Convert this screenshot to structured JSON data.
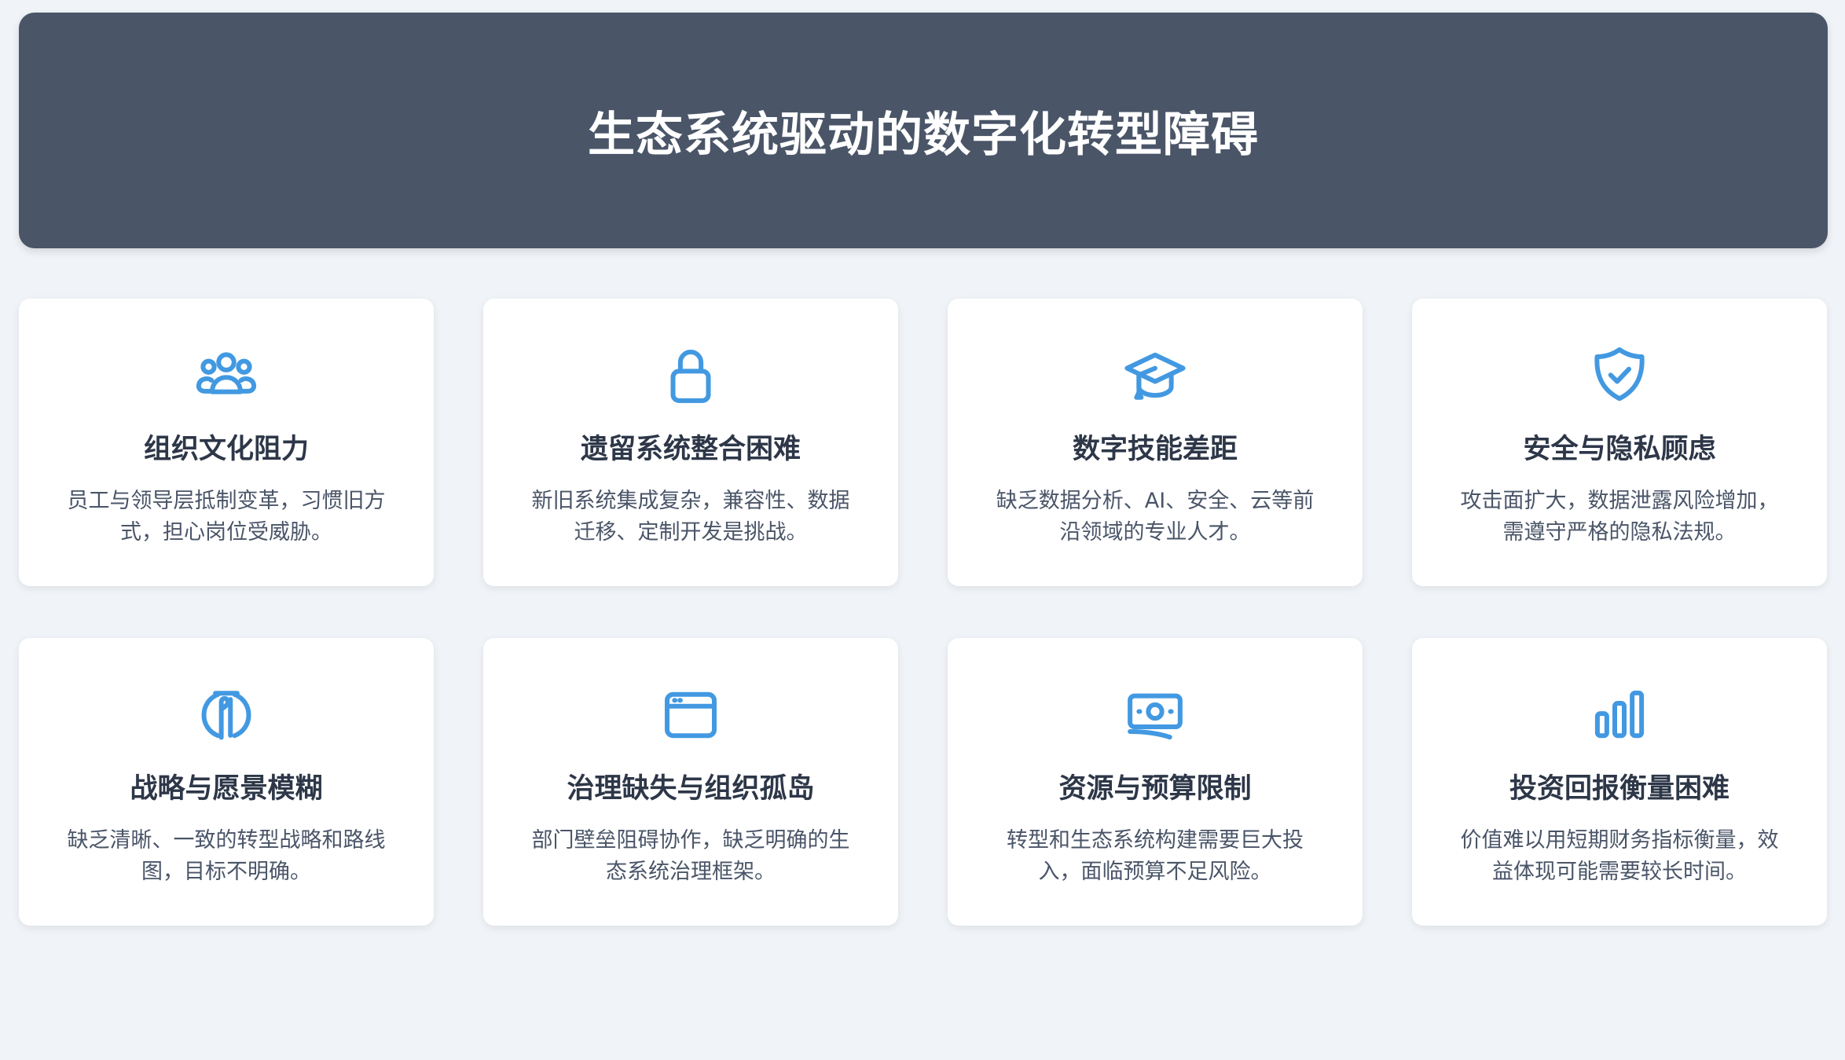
{
  "page_title": "生态系统驱动的数字化转型障碍",
  "accent_color": "#4299e1",
  "cards": [
    {
      "icon": "users-icon",
      "title": "组织文化阻力",
      "desc": "员工与领导层抵制变革，习惯旧方式，担心岗位受威胁。"
    },
    {
      "icon": "lock-icon",
      "title": "遗留系统整合困难",
      "desc": "新旧系统集成复杂，兼容性、数据迁移、定制开发是挑战。"
    },
    {
      "icon": "graduation-cap-icon",
      "title": "数字技能差距",
      "desc": "缺乏数据分析、AI、安全、云等前沿领域的专业人才。"
    },
    {
      "icon": "shield-check-icon",
      "title": "安全与隐私顾虑",
      "desc": "攻击面扩大，数据泄露风险增加，需遵守严格的隐私法规。"
    },
    {
      "icon": "strategy-icon",
      "title": "战略与愿景模糊",
      "desc": "缺乏清晰、一致的转型战略和路线图，目标不明确。"
    },
    {
      "icon": "browser-window-icon",
      "title": "治理缺失与组织孤岛",
      "desc": "部门壁垒阻碍协作，缺乏明确的生态系统治理框架。"
    },
    {
      "icon": "money-icon",
      "title": "资源与预算限制",
      "desc": "转型和生态系统构建需要巨大投入，面临预算不足风险。"
    },
    {
      "icon": "bar-chart-icon",
      "title": "投资回报衡量困难",
      "desc": "价值难以用短期财务指标衡量，效益体现可能需要较长时间。"
    }
  ]
}
